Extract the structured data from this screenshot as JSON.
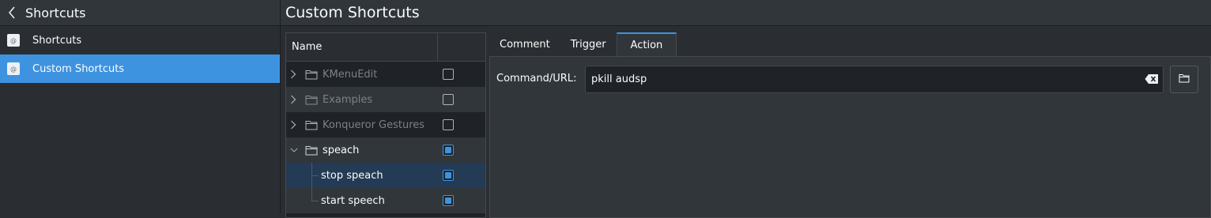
{
  "sidebar": {
    "title": "Shortcuts",
    "items": [
      {
        "label": "Shortcuts",
        "selected": false
      },
      {
        "label": "Custom Shortcuts",
        "selected": true
      }
    ]
  },
  "main": {
    "title": "Custom Shortcuts",
    "tree": {
      "column_name": "Name",
      "rows": [
        {
          "name": "KMenuEdit",
          "checked": false,
          "enabled": false
        },
        {
          "name": "Examples",
          "checked": false,
          "enabled": false
        },
        {
          "name": "Konqueror Gestures",
          "checked": false,
          "enabled": false
        },
        {
          "name": "speach",
          "checked": true,
          "enabled": true,
          "expanded": true
        },
        {
          "name": "stop speach",
          "checked": true,
          "enabled": true,
          "selected": true
        },
        {
          "name": "start speech",
          "checked": true,
          "enabled": true
        }
      ]
    },
    "tabs": [
      {
        "label": "Comment",
        "active": false
      },
      {
        "label": "Trigger",
        "active": false
      },
      {
        "label": "Action",
        "active": true
      }
    ],
    "action": {
      "command_label": "Command/URL:",
      "command_value": "pkill audsp"
    }
  },
  "colors": {
    "accent": "#3d93e0",
    "background": "#2a2e32",
    "panel": "#31363b"
  }
}
